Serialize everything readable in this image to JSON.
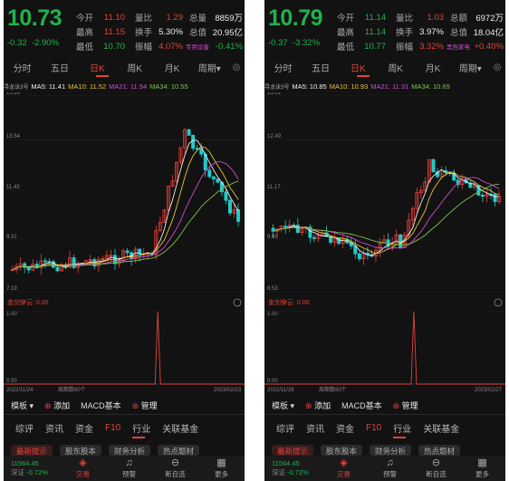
{
  "left": {
    "price": "10.73",
    "change": "-0.32",
    "change_pct": "-2.90%",
    "stats": [
      {
        "k1": "今开",
        "v1": "11.10",
        "k2": "量比",
        "v2": "1.29",
        "k3": "总量",
        "v3": "8859万"
      },
      {
        "k1": "最高",
        "v1": "11.15",
        "k2": "换手",
        "v2": "5.30%",
        "k3": "总值",
        "v3": "20.95亿"
      },
      {
        "k1": "最低",
        "v1": "10.70",
        "k2": "振幅",
        "v2": "4.07%",
        "k3": "",
        "v3": "-0.41%",
        "extra": "专用设备"
      }
    ],
    "ma": {
      "label": "寻龙诀3号",
      "ma5": "MA5: 11.41",
      "ma10": "MA10: 11.52",
      "ma21": "MA21: 11.94",
      "ma34": "MA34: 10.55"
    },
    "y_ticks": [
      "15.89",
      "13.54",
      "11.43",
      "9.31",
      "7.19"
    ],
    "date_start": "2022/11/24",
    "date_end": "2023/02/23",
    "period_label": "周期数60个",
    "indicator": "金剑穿云: 0.00",
    "sub_ticks": [
      "1.00",
      "0.00"
    ]
  },
  "right": {
    "price": "10.79",
    "change": "-0.37",
    "change_pct": "-3.32%",
    "stats": [
      {
        "k1": "今开",
        "v1": "11.14",
        "k2": "量比",
        "v2": "1.03",
        "k3": "总额",
        "v3": "6972万"
      },
      {
        "k1": "最高",
        "v1": "11.14",
        "k2": "换手",
        "v2": "3.97%",
        "k3": "总值",
        "v3": "18.04亿"
      },
      {
        "k1": "最低",
        "v1": "10.77",
        "k2": "振幅",
        "v2": "3.32%",
        "k3": "",
        "v3": "+0.40%",
        "extra": "黑色家电"
      }
    ],
    "ma": {
      "label": "寻龙诀3号",
      "ma5": "MA5: 10.85",
      "ma10": "MA10: 10.93",
      "ma21": "MA21: 11.31",
      "ma34": "MA34: 10.69"
    },
    "y_ticks": [
      "13.81",
      "12.49",
      "11.17",
      "9.85",
      "8.53"
    ],
    "date_start": "2022/11/28",
    "date_end": "2023/02/27",
    "period_label": "周期数60个",
    "indicator": "金剑穿云: 0.00",
    "sub_ticks": [
      "1.00",
      "0.00"
    ]
  },
  "period_tabs": [
    "分时",
    "五日",
    "日K",
    "周K",
    "月K",
    "周期▾"
  ],
  "active_period": "日K",
  "toolbar": {
    "template": "模板",
    "add": "添加",
    "macd": "MACD基本",
    "manage": "管理"
  },
  "f10_tabs": [
    "综评",
    "资讯",
    "资金",
    "F10",
    "行业",
    "关联基金"
  ],
  "active_f10": "F10",
  "sub_tabs": [
    "最新提示",
    "股东股本",
    "财务分析",
    "热点题材"
  ],
  "bottom": {
    "index_value": "11564.45",
    "index_name": "深证",
    "index_change": "-0.72%",
    "nav": [
      "交易",
      "预警",
      "断自选",
      "更多"
    ]
  },
  "colors": {
    "up": "#e3413a",
    "down": "#22b14c",
    "bg": "#121212"
  }
}
